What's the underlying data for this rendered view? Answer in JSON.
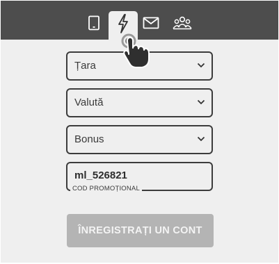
{
  "tabs": [
    {
      "icon": "mobile-phone-icon"
    },
    {
      "icon": "lightning-bolt-icon",
      "active": true
    },
    {
      "icon": "envelope-icon"
    },
    {
      "icon": "user-group-icon"
    }
  ],
  "form": {
    "country": {
      "value": "Țara"
    },
    "currency": {
      "value": "Valută"
    },
    "bonus": {
      "value": "Bonus"
    },
    "promo": {
      "value": "ml_526821",
      "label": "COD PROMOȚIONAL"
    },
    "submit_label": "ÎNREGISTRAȚI UN CONT"
  },
  "colors": {
    "topbar": "#4d4d4d",
    "background": "#efefef",
    "button_disabled": "#b4b4b4",
    "border": "#3c3c3c"
  }
}
